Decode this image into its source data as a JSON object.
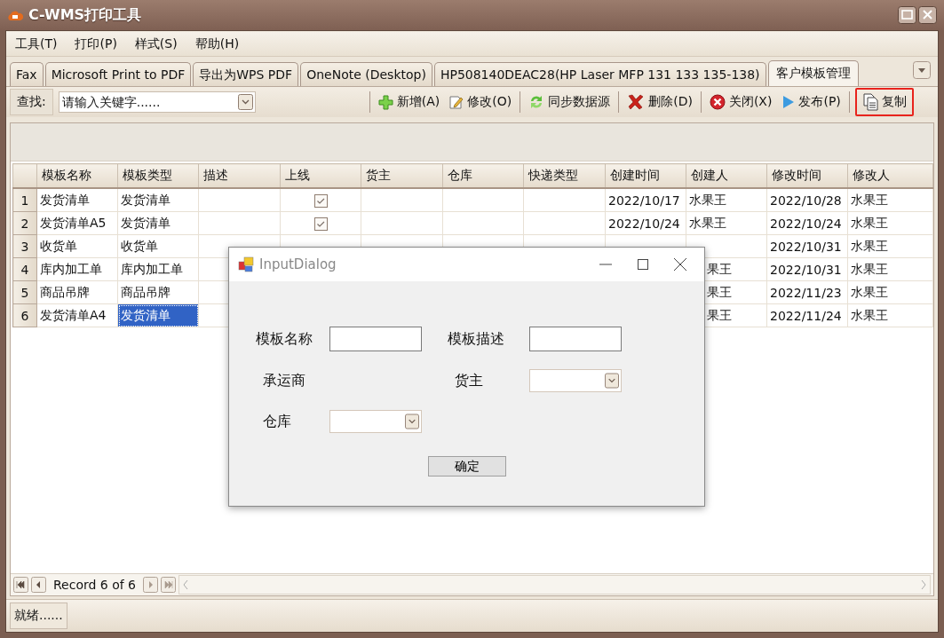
{
  "window": {
    "title": "C-WMS打印工具"
  },
  "menu": [
    {
      "label": "工具(T)"
    },
    {
      "label": "打印(P)"
    },
    {
      "label": "样式(S)"
    },
    {
      "label": "帮助(H)"
    }
  ],
  "tabs": [
    {
      "label": "Fax",
      "selected": false
    },
    {
      "label": "Microsoft Print to PDF",
      "selected": false
    },
    {
      "label": "导出为WPS PDF",
      "selected": false
    },
    {
      "label": "OneNote (Desktop)",
      "selected": false
    },
    {
      "label": "HP508140DEAC28(HP Laser MFP 131 133 135-138)",
      "selected": false
    },
    {
      "label": "客户模板管理",
      "selected": true
    }
  ],
  "search": {
    "label": "查找:",
    "placeholder": "请输入关键字......"
  },
  "toolbar": [
    {
      "label": "新增(A)",
      "kind": "add",
      "separator_before": true,
      "highlighted": false
    },
    {
      "label": "修改(O)",
      "kind": "edit",
      "separator_before": false,
      "highlighted": false
    },
    {
      "label": "同步数据源",
      "kind": "sync",
      "separator_before": true,
      "highlighted": false
    },
    {
      "label": "删除(D)",
      "kind": "delete",
      "separator_before": true,
      "highlighted": false
    },
    {
      "label": "关闭(X)",
      "kind": "close",
      "separator_before": true,
      "highlighted": false
    },
    {
      "label": "发布(P)",
      "kind": "publish",
      "separator_before": false,
      "highlighted": false
    },
    {
      "label": "复制",
      "kind": "copy",
      "separator_before": true,
      "highlighted": true
    }
  ],
  "table": {
    "columns": [
      "模板名称",
      "模板类型",
      "描述",
      "上线",
      "货主",
      "仓库",
      "快递类型",
      "创建时间",
      "创建人",
      "修改时间",
      "修改人"
    ],
    "rows": [
      {
        "number": "1",
        "name": "发货清单",
        "type": "发货清单",
        "online": true,
        "created": "2022/10/17",
        "creator": "水果王",
        "modified": "2022/10/28",
        "modifier": "水果王",
        "selected": false
      },
      {
        "number": "2",
        "name": "发货清单A5",
        "type": "发货清单",
        "online": true,
        "created": "2022/10/24",
        "creator": "水果王",
        "modified": "2022/10/24",
        "modifier": "水果王",
        "selected": false
      },
      {
        "number": "3",
        "name": "收货单",
        "type": "收货单",
        "modified": "2022/10/31",
        "modifier": "水果王",
        "selected": false
      },
      {
        "number": "4",
        "name": "库内加工单",
        "type": "库内加工单",
        "creator": "果王",
        "modified": "2022/10/31",
        "modifier": "水果王",
        "selected": false
      },
      {
        "number": "5",
        "name": "商品吊牌",
        "type": "商品吊牌",
        "creator": "果王",
        "modified": "2022/11/23",
        "modifier": "水果王",
        "selected": false
      },
      {
        "number": "6",
        "name": "发货清单A4",
        "type": "发货清单",
        "creator": "果王",
        "modified": "2022/11/24",
        "modifier": "水果王",
        "selected": true
      }
    ]
  },
  "navigator": {
    "record": "Record 6 of 6"
  },
  "status_bar": {
    "text": "就绪......"
  },
  "dialog": {
    "title": "InputDialog",
    "fields": [
      {
        "label": "模板名称",
        "kind": "text"
      },
      {
        "label": "模板描述",
        "kind": "text"
      },
      {
        "label": "承运商",
        "kind": "label"
      },
      {
        "label": "货主",
        "kind": "combo"
      },
      {
        "label": "仓库",
        "kind": "combo"
      }
    ],
    "button": "确定"
  }
}
